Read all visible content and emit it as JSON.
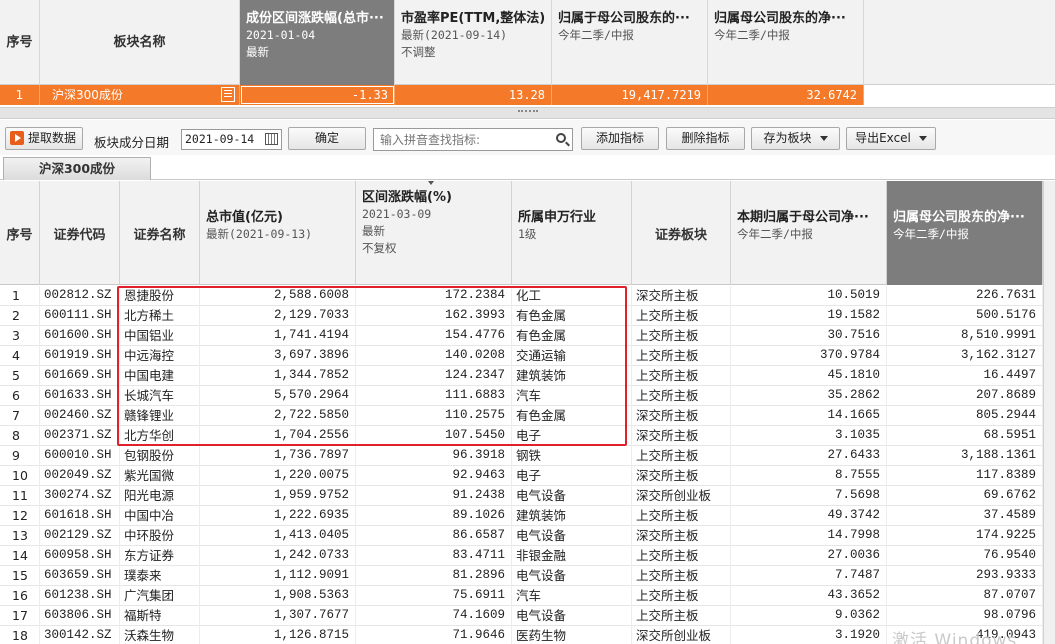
{
  "summary": {
    "headers": {
      "seq": "序号",
      "sector_name": "板块名称",
      "return_title": "成份区间涨跌幅(总市···",
      "return_date": "2021-01-04",
      "return_note": "最新",
      "pe_title": "市盈率PE(TTM,整体法)",
      "pe_date": "最新(2021-09-14)",
      "pe_note": "不调整",
      "profit1_title": "归属于母公司股东的···",
      "profit1_period": "今年二季/中报",
      "profit2_title": "归属母公司股东的净···",
      "profit2_period": "今年二季/中报"
    },
    "row": {
      "seq": "1",
      "sector_name": "沪深300成份",
      "return": "-1.33",
      "pe": "13.28",
      "profit1": "19,417.7219",
      "profit2": "32.6742"
    }
  },
  "toolbar": {
    "fetch_label": "提取数据",
    "date_label": "板块成分日期",
    "date_value": "2021-09-14",
    "confirm_label": "确定",
    "search_placeholder": "输入拼音查找指标:",
    "add_indicator_label": "添加指标",
    "delete_indicator_label": "删除指标",
    "save_as_sector_label": "存为板块",
    "export_excel_label": "导出Excel"
  },
  "tab": {
    "label": "沪深300成份"
  },
  "table": {
    "headers": {
      "seq": "序号",
      "code": "证券代码",
      "name": "证券名称",
      "mcap_title": "总市值(亿元)",
      "mcap_sub": "最新(2021-09-13)",
      "chg_title": "区间涨跌幅(%)",
      "chg_date": "2021-03-09",
      "chg_note1": "最新",
      "chg_note2": "不复权",
      "industry_title": "所属申万行业",
      "industry_sub": "1级",
      "board": "证券板块",
      "profit1_title": "本期归属于母公司净···",
      "profit1_sub": "今年二季/中报",
      "profit2_title": "归属母公司股东的净···",
      "profit2_sub": "今年二季/中报"
    },
    "rows": [
      {
        "seq": "1",
        "code": "002812.SZ",
        "name": "恩捷股份",
        "mcap": "2,588.6008",
        "chg": "172.2384",
        "industry": "化工",
        "board": "深交所主板",
        "p1": "10.5019",
        "p2": "226.7631"
      },
      {
        "seq": "2",
        "code": "600111.SH",
        "name": "北方稀土",
        "mcap": "2,129.7033",
        "chg": "162.3993",
        "industry": "有色金属",
        "board": "上交所主板",
        "p1": "19.1582",
        "p2": "500.5176"
      },
      {
        "seq": "3",
        "code": "601600.SH",
        "name": "中国铝业",
        "mcap": "1,741.4194",
        "chg": "154.4776",
        "industry": "有色金属",
        "board": "上交所主板",
        "p1": "30.7516",
        "p2": "8,510.9991"
      },
      {
        "seq": "4",
        "code": "601919.SH",
        "name": "中远海控",
        "mcap": "3,697.3896",
        "chg": "140.0208",
        "industry": "交通运输",
        "board": "上交所主板",
        "p1": "370.9784",
        "p2": "3,162.3127"
      },
      {
        "seq": "5",
        "code": "601669.SH",
        "name": "中国电建",
        "mcap": "1,344.7852",
        "chg": "124.2347",
        "industry": "建筑装饰",
        "board": "上交所主板",
        "p1": "45.1810",
        "p2": "16.4497"
      },
      {
        "seq": "6",
        "code": "601633.SH",
        "name": "长城汽车",
        "mcap": "5,570.2964",
        "chg": "111.6883",
        "industry": "汽车",
        "board": "上交所主板",
        "p1": "35.2862",
        "p2": "207.8689"
      },
      {
        "seq": "7",
        "code": "002460.SZ",
        "name": "赣锋锂业",
        "mcap": "2,722.5850",
        "chg": "110.2575",
        "industry": "有色金属",
        "board": "深交所主板",
        "p1": "14.1665",
        "p2": "805.2944"
      },
      {
        "seq": "8",
        "code": "002371.SZ",
        "name": "北方华创",
        "mcap": "1,704.2556",
        "chg": "107.5450",
        "industry": "电子",
        "board": "深交所主板",
        "p1": "3.1035",
        "p2": "68.5951"
      },
      {
        "seq": "9",
        "code": "600010.SH",
        "name": "包钢股份",
        "mcap": "1,736.7897",
        "chg": "96.3918",
        "industry": "钢铁",
        "board": "上交所主板",
        "p1": "27.6433",
        "p2": "3,188.1361"
      },
      {
        "seq": "10",
        "code": "002049.SZ",
        "name": "紫光国微",
        "mcap": "1,220.0075",
        "chg": "92.9463",
        "industry": "电子",
        "board": "深交所主板",
        "p1": "8.7555",
        "p2": "117.8389"
      },
      {
        "seq": "11",
        "code": "300274.SZ",
        "name": "阳光电源",
        "mcap": "1,959.9752",
        "chg": "91.2438",
        "industry": "电气设备",
        "board": "深交所创业板",
        "p1": "7.5698",
        "p2": "69.6762"
      },
      {
        "seq": "12",
        "code": "601618.SH",
        "name": "中国中冶",
        "mcap": "1,222.6935",
        "chg": "89.1026",
        "industry": "建筑装饰",
        "board": "上交所主板",
        "p1": "49.3742",
        "p2": "37.4589"
      },
      {
        "seq": "13",
        "code": "002129.SZ",
        "name": "中环股份",
        "mcap": "1,413.0405",
        "chg": "86.6587",
        "industry": "电气设备",
        "board": "深交所主板",
        "p1": "14.7998",
        "p2": "174.9225"
      },
      {
        "seq": "14",
        "code": "600958.SH",
        "name": "东方证券",
        "mcap": "1,242.0733",
        "chg": "83.4711",
        "industry": "非银金融",
        "board": "上交所主板",
        "p1": "27.0036",
        "p2": "76.9540"
      },
      {
        "seq": "15",
        "code": "603659.SH",
        "name": "璞泰来",
        "mcap": "1,112.9091",
        "chg": "81.2896",
        "industry": "电气设备",
        "board": "上交所主板",
        "p1": "7.7487",
        "p2": "293.9333"
      },
      {
        "seq": "16",
        "code": "601238.SH",
        "name": "广汽集团",
        "mcap": "1,908.5363",
        "chg": "75.6911",
        "industry": "汽车",
        "board": "上交所主板",
        "p1": "43.3652",
        "p2": "87.0707"
      },
      {
        "seq": "17",
        "code": "603806.SH",
        "name": "福斯特",
        "mcap": "1,307.7677",
        "chg": "74.1609",
        "industry": "电气设备",
        "board": "上交所主板",
        "p1": "9.0362",
        "p2": "98.0796"
      },
      {
        "seq": "18",
        "code": "300142.SZ",
        "name": "沃森生物",
        "mcap": "1,126.8715",
        "chg": "71.9646",
        "industry": "医药生物",
        "board": "深交所创业板",
        "p1": "3.1920",
        "p2": "419.0943"
      }
    ]
  },
  "watermark": "激活 Windows",
  "colors": {
    "accent_orange": "#f47a2a",
    "highlight_red": "#e0212b",
    "active_header": "#7d7d7d"
  }
}
